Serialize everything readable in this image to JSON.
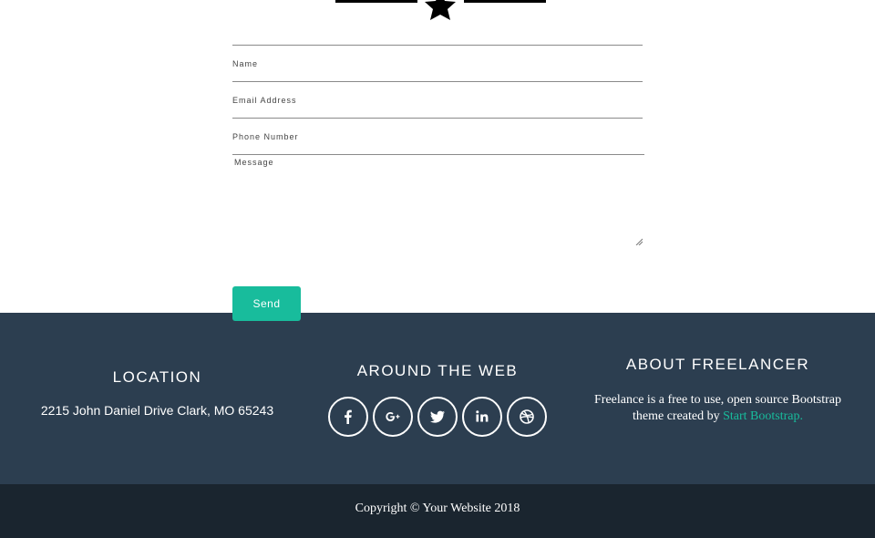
{
  "form": {
    "name_label": "Name",
    "email_label": "Email Address",
    "phone_label": "Phone Number",
    "message_label": "Message",
    "send_label": "Send"
  },
  "footer": {
    "location": {
      "title": "LOCATION",
      "address": "2215 John Daniel Drive Clark, MO 65243"
    },
    "web": {
      "title": "AROUND THE WEB",
      "icons": [
        "facebook-icon",
        "google-plus-icon",
        "twitter-icon",
        "linkedin-icon",
        "dribbble-icon"
      ]
    },
    "about": {
      "title": "ABOUT FREELANCER",
      "text": "Freelance is a free to use, open source Bootstrap theme created by",
      "link": "Start Bootstrap."
    },
    "copyright": "Copyright © Your Website 2018"
  },
  "colors": {
    "accent": "#18bc9c",
    "footer_bg": "#2c3e50",
    "copyright_bg": "#1a252f"
  }
}
